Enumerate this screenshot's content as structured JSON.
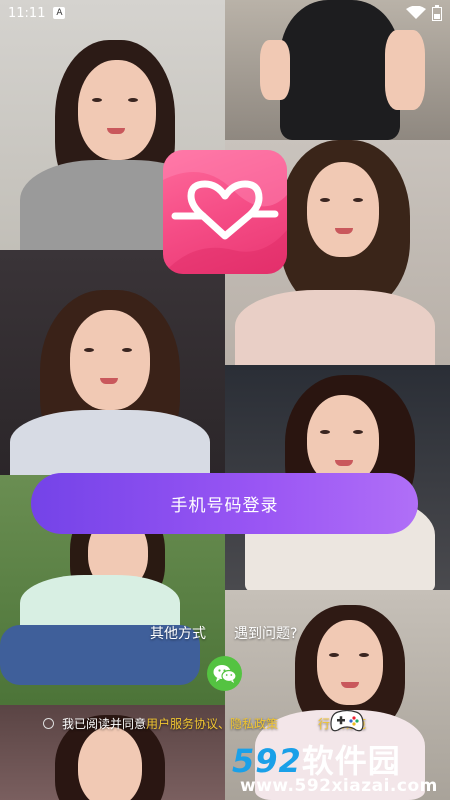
{
  "status_bar": {
    "time": "11:11",
    "input_badge": "A"
  },
  "app": {
    "logo_name": "heartbeat-logo",
    "accent_color": "#f54d86"
  },
  "login": {
    "phone_login_label": "手机号码登录",
    "button_gradient": [
      "#7443e8",
      "#b06ff7"
    ]
  },
  "secondary": {
    "other_methods_label": "其他方式",
    "help_label": "遇到问题?",
    "wechat_icon": "wechat-icon"
  },
  "agreement": {
    "prefix": "我已阅读并同意",
    "user_agreement": "用户服务协议、",
    "privacy_policy": "隐私政策",
    "conduct_rules": "行为规范"
  },
  "watermark": {
    "brand": "592",
    "brand_cn": "软件园",
    "url": "www.592xiazai.com"
  }
}
